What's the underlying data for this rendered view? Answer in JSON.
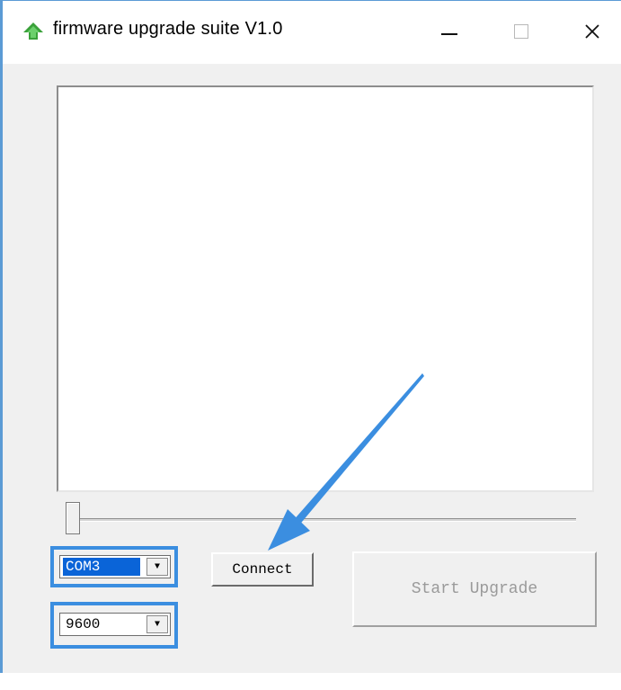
{
  "window": {
    "title": "firmware upgrade suite V1.0",
    "icon": "green-up-arrow-icon",
    "controls": {
      "minimize_icon": "minimize-icon",
      "maximize_icon": "maximize-icon",
      "close_glyph": "✕"
    }
  },
  "log": {
    "content": ""
  },
  "progress": {
    "value": 0
  },
  "serial": {
    "port": {
      "selected": "COM3"
    },
    "baud": {
      "selected": "9600"
    }
  },
  "buttons": {
    "connect_label": "Connect",
    "upgrade_label": "Start Upgrade",
    "upgrade_enabled": false
  },
  "colors": {
    "highlight": "#3b8ee0",
    "selection": "#0a64d8",
    "annotation_arrow": "#3b8ee0"
  }
}
